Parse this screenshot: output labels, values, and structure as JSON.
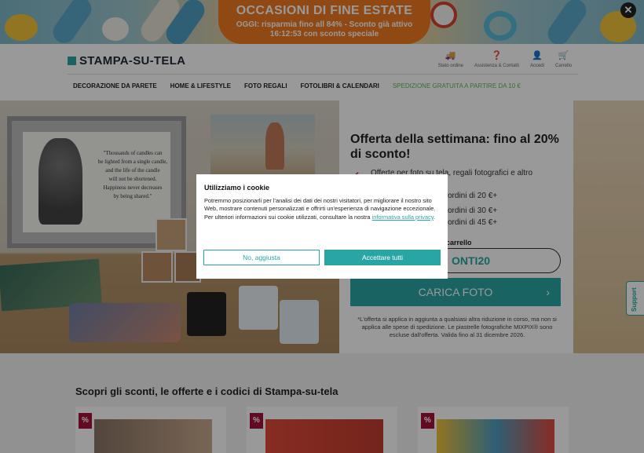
{
  "promo": {
    "title": "OCCASIONI DI FINE ESTATE",
    "line1": "OGGI: risparmia fino all 84% - Sconto già attivo",
    "line2": "16:12:53 con sconto speciale",
    "close_icon": "close-icon"
  },
  "header": {
    "logo": "STAMPA-SU-TELA",
    "icons": [
      {
        "icon": "truck-icon",
        "label": "Stato ordine"
      },
      {
        "icon": "help-icon",
        "label": "Assistenza & Contatti"
      },
      {
        "icon": "user-icon",
        "label": "Accedi"
      },
      {
        "icon": "cart-icon",
        "label": "Carrello"
      }
    ],
    "nav": [
      "DECORAZIONE DA PARETE",
      "HOME & LIFESTYLE",
      "FOTO REGALI",
      "FOTOLIBRI & CALENDARI",
      "SPEDIZIONE GRATUITA A PARTIRE DA 10 €"
    ]
  },
  "hero": {
    "quote_lines": [
      "\"Thousands of candles can",
      "be lighted from a single candle,",
      "and the life of the candle",
      "will not be shortened.",
      "Happiness never decreases",
      "by being shared.\""
    ],
    "offer_title": "Offerta della settimana: fino al 20% di sconto!",
    "offer_first": "Offerte per foto su tela, regali fotografici e altro",
    "tiers": [
      "ordini di 20 €+",
      "ordini di 30 €+",
      "ordini di 45 €+"
    ],
    "cart_label": "carrello",
    "code": "ONTI20",
    "upload_button": "CARICA FOTO",
    "disclaimer": "*L'offerta si applica in aggiunta a qualsiasi altra riduzione in corso, ma non si applica alle spese di spedizione. Le piastrelle fotografiche MIXPIX® sono escluse dall'offerta. Valida fino al 31 dicembre 2026."
  },
  "section": {
    "title": "Scopri gli sconti, le offerte e i codici di Stampa-su-tela",
    "badge": "%"
  },
  "support": "Support",
  "cookie": {
    "title": "Utilizziamo i cookie",
    "text": "Potremmo posizionarli per l'analisi dei dati dei nostri visitatori, per migliorare il nostro sito Web, mostrare contenuti personalizzati e offrirti un'esperienza di navigazione eccezionale. Per ulteriori informazioni sui cookie utilizzati, consultare la nostra ",
    "link": "informativa sulla privacy",
    "after_link": ".",
    "decline": "No, aggiusta",
    "accept": "Accettare tutti"
  },
  "colors": {
    "accent": "#2aa5a5",
    "promo_orange": "#f07a1e",
    "badge": "#a3123a"
  }
}
